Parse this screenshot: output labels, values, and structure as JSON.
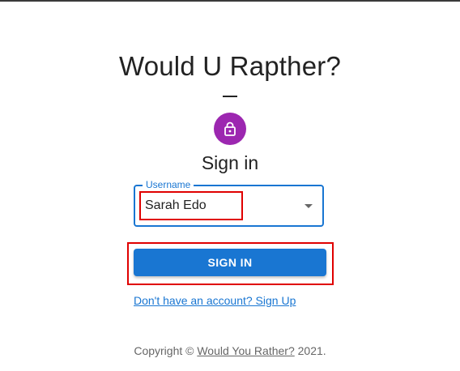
{
  "app_title": "Would U Rapther?",
  "avatar_icon": "lock-icon",
  "signin_heading": "Sign in",
  "username_field": {
    "label": "Username",
    "value": "Sarah Edo"
  },
  "signin_button_label": "SIGN IN",
  "signup_link": "Don't have an account? Sign Up",
  "footer": {
    "prefix": "Copyright © ",
    "link": "Would You Rather?",
    "suffix": " 2021."
  },
  "colors": {
    "primary": "#1976d2",
    "avatar": "#9c27b0",
    "highlight": "#e00000"
  }
}
